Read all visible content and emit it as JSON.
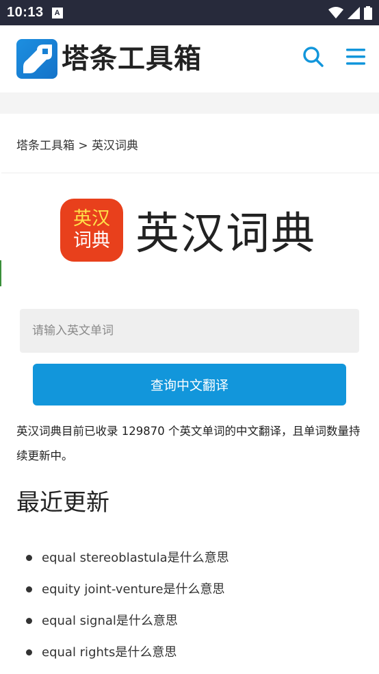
{
  "status_bar": {
    "time": "10:13",
    "notification_glyph": "A"
  },
  "header": {
    "logo_text": "塔条工具箱",
    "icons": [
      "search-icon",
      "menu-icon"
    ]
  },
  "breadcrumb": {
    "home": "塔条工具箱",
    "separator": ">",
    "current": "英汉词典"
  },
  "app": {
    "icon_line1": "英汉",
    "icon_line2": "词典",
    "title": "英汉词典"
  },
  "search": {
    "placeholder": "请输入英文单词",
    "value": "",
    "button_label": "查询中文翻译"
  },
  "description": "英汉词典目前已收录 129870 个英文单词的中文翻译，且单词数量持续更新中。",
  "recent": {
    "title": "最近更新",
    "items": [
      "equal stereoblastula是什么意思",
      "equity joint-venture是什么意思",
      "equal signal是什么意思",
      "equal rights是什么意思"
    ]
  },
  "colors": {
    "accent": "#1296db",
    "status_bar": "#272a3b",
    "app_icon_bg": "#e8401c",
    "app_icon_text": "#ffe14a"
  }
}
